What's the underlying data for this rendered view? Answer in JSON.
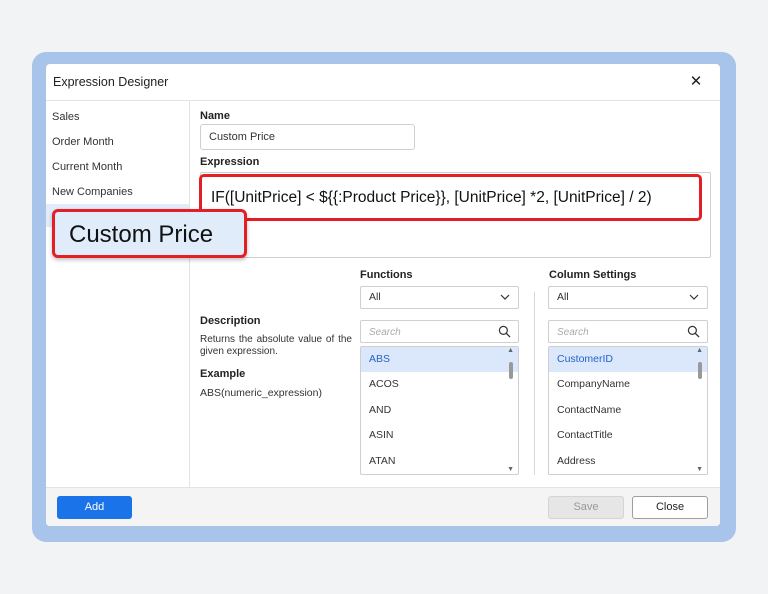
{
  "dialog": {
    "title": "Expression Designer"
  },
  "sidebar": {
    "items": [
      {
        "label": "Sales"
      },
      {
        "label": "Order Month"
      },
      {
        "label": "Current Month"
      },
      {
        "label": "New Companies"
      }
    ],
    "selected_label": "Custom Price"
  },
  "form": {
    "name_label": "Name",
    "name_value": "Custom Price",
    "expression_label": "Expression",
    "expression_value": "IF([UnitPrice] < ${{:Product Price}}, [UnitPrice] *2, [UnitPrice] / 2)"
  },
  "info": {
    "description_label": "Description",
    "description_text": "Returns the absolute value of the given expression.",
    "example_label": "Example",
    "example_text": "ABS(numeric_expression)"
  },
  "functions": {
    "label": "Functions",
    "filter": "All",
    "search_placeholder": "Search",
    "items": [
      "ABS",
      "ACOS",
      "AND",
      "ASIN",
      "ATAN"
    ],
    "selected": "ABS"
  },
  "columns": {
    "label": "Column Settings",
    "filter": "All",
    "search_placeholder": "Search",
    "items": [
      "CustomerID",
      "CompanyName",
      "ContactName",
      "ContactTitle",
      "Address"
    ],
    "selected": "CustomerID"
  },
  "footer": {
    "add_label": "Add",
    "save_label": "Save",
    "close_label": "Close"
  },
  "colors": {
    "accent": "#1a73e8",
    "highlight_border": "#e31e24",
    "selection_bg": "#e1ecfb",
    "frame": "#a9c4ea"
  },
  "icons": {
    "close": "close-icon",
    "dropdown": "chevron-down-icon",
    "search": "search-icon"
  }
}
